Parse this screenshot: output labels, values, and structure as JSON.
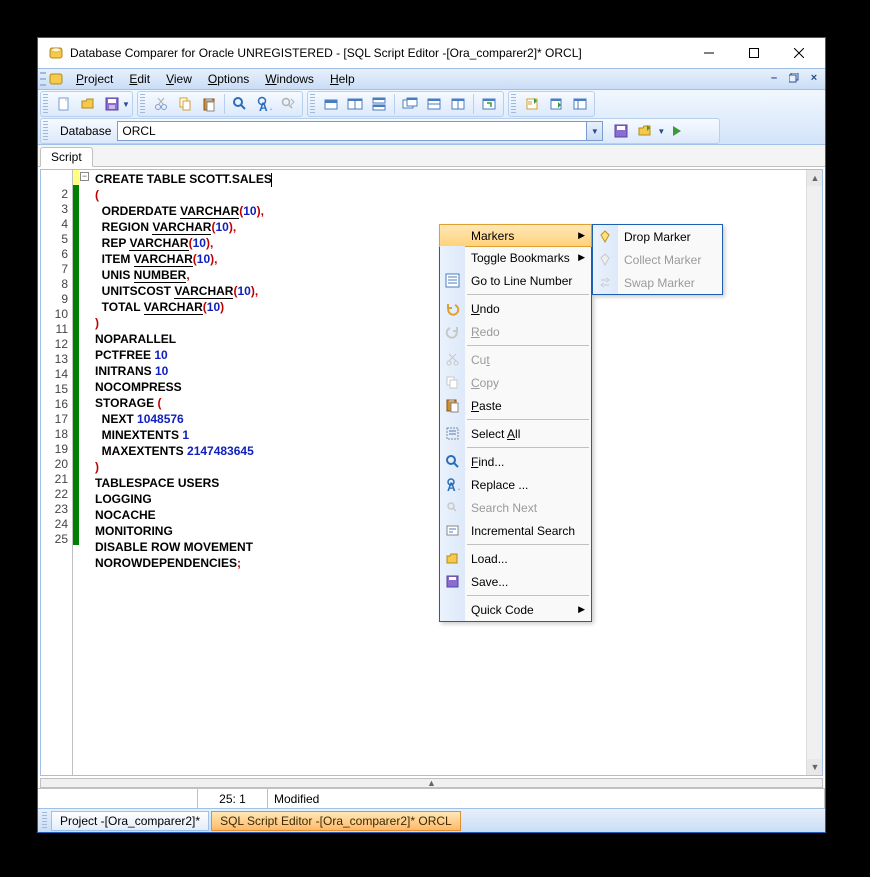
{
  "window": {
    "title": "Database Comparer for Oracle UNREGISTERED - [SQL Script Editor -[Ora_comparer2]* ORCL]"
  },
  "menu": {
    "items": [
      "Project",
      "Edit",
      "View",
      "Options",
      "Windows",
      "Help"
    ],
    "underlines": [
      "P",
      "E",
      "V",
      "O",
      "W",
      "H"
    ]
  },
  "dbbar": {
    "label": "Database",
    "value": "ORCL"
  },
  "tab_script": "Script",
  "code": {
    "lines": [
      "CREATE TABLE SCOTT.SALES",
      "(",
      "  ORDERDATE VARCHAR(10),",
      "  REGION VARCHAR(10),",
      "  REP VARCHAR(10),",
      "  ITEM VARCHAR(10),",
      "  UNIS NUMBER,",
      "  UNITSCOST VARCHAR(10),",
      "  TOTAL VARCHAR(10)",
      ")",
      "NOPARALLEL",
      "PCTFREE 10",
      "INITRANS 10",
      "NOCOMPRESS",
      "STORAGE (",
      "  NEXT 1048576",
      "  MINEXTENTS 1",
      "  MAXEXTENTS 2147483645",
      ")",
      "TABLESPACE USERS",
      "LOGGING",
      "NOCACHE",
      "MONITORING",
      "DISABLE ROW MOVEMENT",
      "NOROWDEPENDENCIES;"
    ]
  },
  "status": {
    "pos": "25:  1",
    "state": "Modified"
  },
  "doctabs": {
    "a": "Project -[Ora_comparer2]*",
    "b": "SQL Script Editor -[Ora_comparer2]* ORCL"
  },
  "context_menu": {
    "markers": "Markers",
    "toggle_bookmarks": "Toggle Bookmarks",
    "goto_line": "Go to Line Number",
    "undo": "Undo",
    "redo": "Redo",
    "cut": "Cut",
    "copy": "Copy",
    "paste": "Paste",
    "select_all": "Select All",
    "find": "Find...",
    "replace": "Replace ...",
    "search_next": "Search Next",
    "inc_search": "Incremental Search",
    "load": "Load...",
    "save": "Save...",
    "quick_code": "Quick Code"
  },
  "submenu": {
    "drop": "Drop Marker",
    "collect": "Collect Marker",
    "swap": "Swap Marker"
  }
}
